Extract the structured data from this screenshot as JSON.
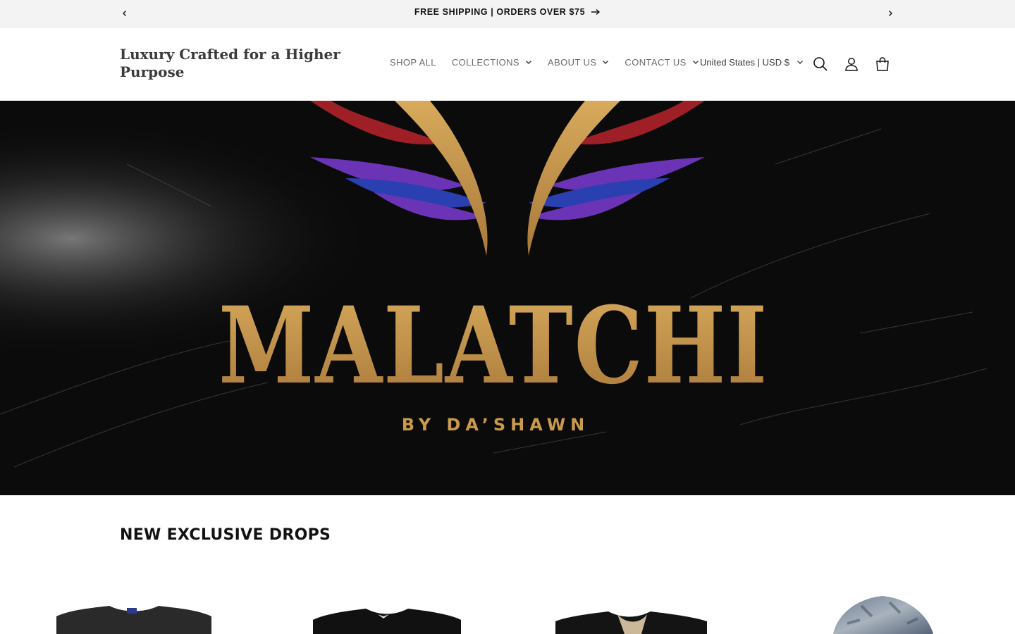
{
  "announcement": {
    "message": "FREE SHIPPING | ORDERS OVER $75",
    "prev_icon": "chevron-left-icon",
    "next_icon": "chevron-right-icon"
  },
  "header": {
    "brand": "Luxury Crafted for a Higher Purpose",
    "nav": [
      {
        "label": "SHOP ALL",
        "has_dropdown": false
      },
      {
        "label": "COLLECTIONS",
        "has_dropdown": true
      },
      {
        "label": "ABOUT US",
        "has_dropdown": true
      },
      {
        "label": "CONTACT US",
        "has_dropdown": true
      }
    ],
    "locale": "United States | USD $",
    "icons": [
      "search-icon",
      "account-icon",
      "cart-icon"
    ]
  },
  "hero": {
    "logo_text": "MALATCHI",
    "logo_subtext": "BY DA’SHAWN",
    "colors": {
      "background": "#0b0b0b",
      "gold": "#c99a4a",
      "red": "#9e1f26",
      "purple": "#6b34b6",
      "blue": "#2a3fb0"
    }
  },
  "section": {
    "title": "NEW EXCLUSIVE DROPS"
  },
  "products": [
    {
      "name": "charcoal-tshirt"
    },
    {
      "name": "black-tshirt-logo"
    },
    {
      "name": "black-shirt-beige-lining"
    },
    {
      "name": "camo-hat"
    }
  ]
}
